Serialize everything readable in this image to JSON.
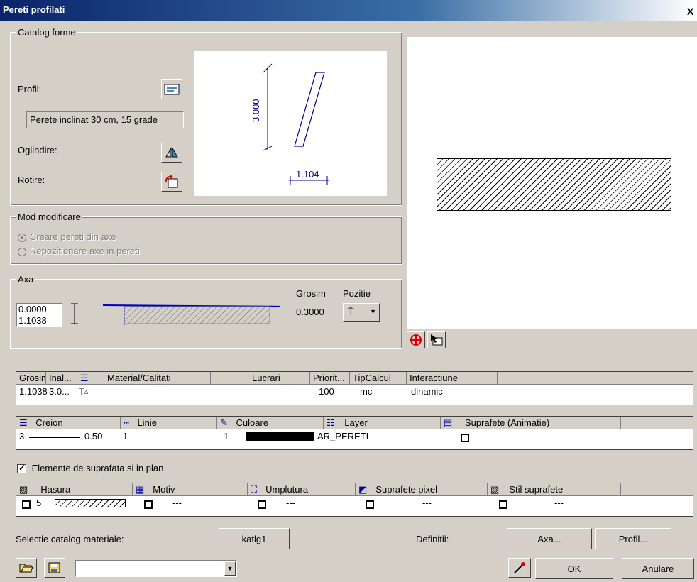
{
  "window": {
    "title": "Pereti profilati",
    "close": "X"
  },
  "catalog": {
    "legend": "Catalog forme",
    "profil_label": "Profil:",
    "profil_value": "Perete inclinat 30 cm, 15 grade",
    "oglindire_label": "Oglindire:",
    "rotire_label": "Rotire:",
    "preview": {
      "height_dim": "3.000",
      "width_dim": "1.104"
    }
  },
  "mod": {
    "legend": "Mod modificare",
    "options": [
      "Creare pereti din axe",
      "Repozitionare axe in pereti"
    ],
    "selected": 0
  },
  "axa": {
    "legend": "Axa",
    "value_top": "0.0000",
    "value_bottom": "1.1038",
    "grosim_label": "Grosim",
    "pozitie_label": "Pozitie",
    "grosim_value": "0.3000"
  },
  "table1": {
    "headers": [
      "Grosim",
      "Inal...",
      "",
      "Material/Calitati",
      "Lucrari",
      "Priorit...",
      "TipCalcul",
      "Interactiune"
    ],
    "row": [
      "1.1038",
      "3.0...",
      "",
      "---",
      "---",
      "100",
      "mc",
      "dinamic"
    ]
  },
  "table2": {
    "headers": [
      "Creion",
      "Linie",
      "Culoare",
      "Layer",
      "Suprafete (Animatie)"
    ],
    "row": {
      "creion_num": "3",
      "creion_w": "0.50",
      "linie": "1",
      "culoare": "1",
      "layer": "AR_PERETI",
      "suprafete": "---"
    }
  },
  "suprafata_check": {
    "label": "Elemente de suprafata si in plan",
    "checked": true
  },
  "table3": {
    "headers": [
      "Hasura",
      "Motiv",
      "Umplutura",
      "Suprafete pixel",
      "Stil suprafete"
    ],
    "row": {
      "hasura_num": "5",
      "motiv": "---",
      "umplutura": "---",
      "pixel": "---",
      "stil": "---"
    }
  },
  "footer": {
    "selectie_label": "Selectie catalog materiale:",
    "katlg_button": "katlg1",
    "definitii_label": "Definitii:",
    "axa_button": "Axa...",
    "profil_button": "Profil...",
    "ok_button": "OK",
    "anulare_button": "Anulare"
  },
  "colors": {
    "accent": "#0a246a",
    "profile_line": "#00008b",
    "red": "#e00000"
  }
}
